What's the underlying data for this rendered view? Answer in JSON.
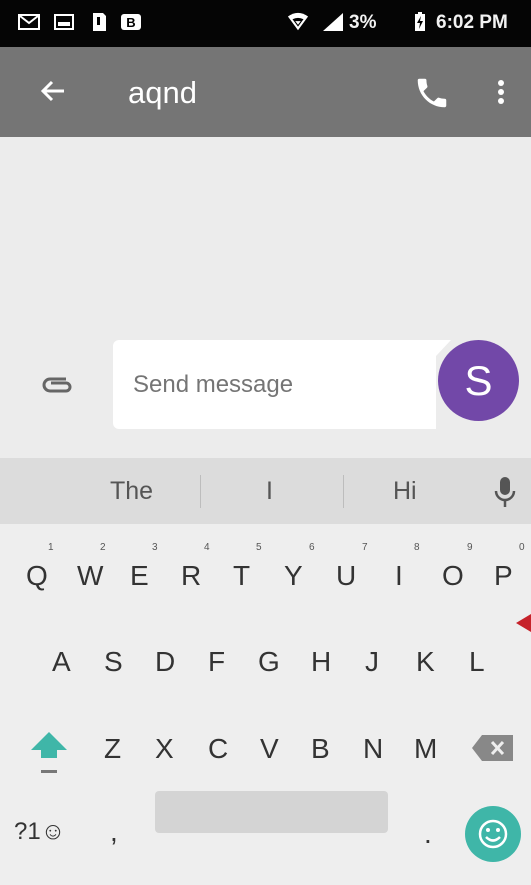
{
  "statusbar": {
    "icons": [
      "gmail-icon",
      "gallery-icon",
      "sim-icon",
      "b-icon",
      "wifi-icon",
      "signal-icon",
      "battery-icon"
    ],
    "battery": "3%",
    "time": "6:02 PM"
  },
  "appbar": {
    "title": "aqnd",
    "back_icon": "arrow-left-icon",
    "call_icon": "phone-icon",
    "more_icon": "more-vertical-icon",
    "color": "#757575"
  },
  "compose": {
    "placeholder": "Send message",
    "attach_icon": "paperclip-icon",
    "avatar_letter": "S",
    "avatar_color": "#7248a8"
  },
  "suggestions": [
    "The",
    "I",
    "Hi"
  ],
  "keyboard": {
    "row1": [
      "Q",
      "W",
      "E",
      "R",
      "T",
      "Y",
      "U",
      "I",
      "O",
      "P"
    ],
    "row1_sup": [
      "1",
      "2",
      "3",
      "4",
      "5",
      "6",
      "7",
      "8",
      "9",
      "0"
    ],
    "row2": [
      "A",
      "S",
      "D",
      "F",
      "G",
      "H",
      "J",
      "K",
      "L"
    ],
    "row3": [
      "Z",
      "X",
      "C",
      "V",
      "B",
      "N",
      "M"
    ],
    "symbols": "?1☺",
    "comma": ",",
    "period": ".",
    "accent": "#3fb6a8"
  }
}
